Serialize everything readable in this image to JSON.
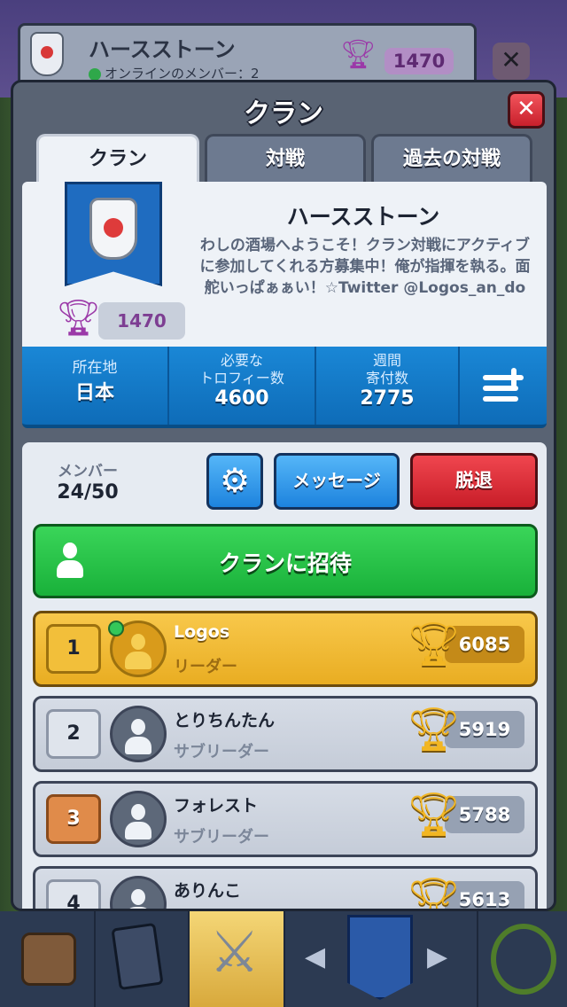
{
  "background": {
    "clan_name": "ハースストーン",
    "online_text": "オンラインのメンバー：2",
    "trophies": "1470"
  },
  "modal": {
    "title": "クラン",
    "close_label": "✕"
  },
  "tabs": [
    {
      "label": "クラン",
      "active": true
    },
    {
      "label": "対戦",
      "active": false
    },
    {
      "label": "過去の対戦",
      "active": false
    }
  ],
  "clan": {
    "name": "ハースストーン",
    "description": "わしの酒場へようこそ！クラン対戦にアクティブに参加してくれる方募集中！俺が指揮を執る。面舵いっぱぁぁい！☆Twitter @Logos_an_do",
    "trophies": "1470"
  },
  "stats": [
    {
      "label": "所在地",
      "value": "日本"
    },
    {
      "label": "必要な\nトロフィー数",
      "value": "4600"
    },
    {
      "label": "週間\n寄付数",
      "value": "2775"
    }
  ],
  "members_panel": {
    "label": "メンバー",
    "count": "24/50",
    "message_label": "メッセージ",
    "leave_label": "脱退",
    "invite_label": "クランに招待"
  },
  "members": [
    {
      "rank": "1",
      "name": "Logos",
      "role": "リーダー",
      "trophies": "6085",
      "online": true
    },
    {
      "rank": "2",
      "name": "とりちんたん",
      "role": "サブリーダー",
      "trophies": "5919",
      "online": false
    },
    {
      "rank": "3",
      "name": "フォレスト",
      "role": "サブリーダー",
      "trophies": "5788",
      "online": false
    },
    {
      "rank": "4",
      "name": "ありんこ",
      "role": "",
      "trophies": "5613",
      "online": false
    }
  ],
  "colors": {
    "accent_blue": "#1d83de",
    "leave_red": "#c81d28",
    "invite_green": "#19b13a",
    "leader_gold": "#e9ad22"
  }
}
